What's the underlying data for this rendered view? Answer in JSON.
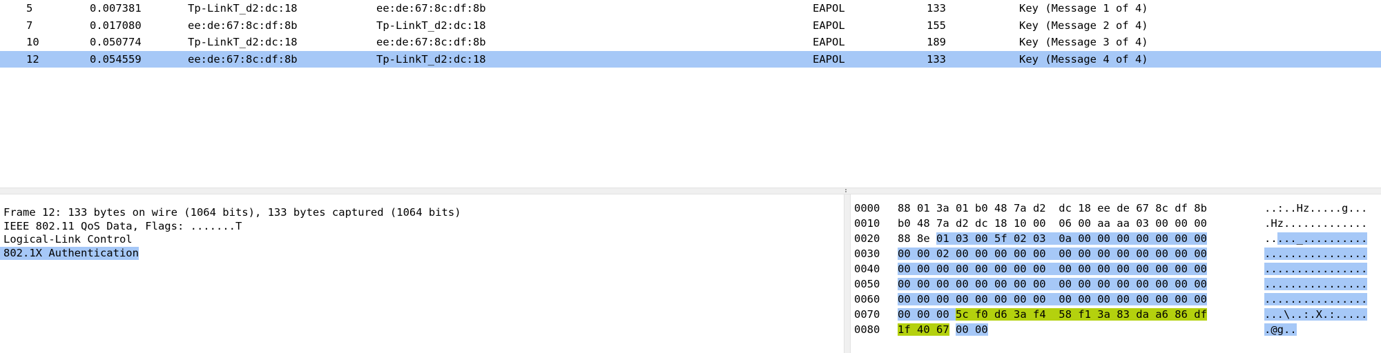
{
  "packet_list": {
    "rows": [
      {
        "no": "5",
        "time": "0.007381",
        "source": "Tp-LinkT_d2:dc:18",
        "destination": "ee:de:67:8c:df:8b",
        "protocol": "EAPOL",
        "length": "133",
        "info": "Key (Message 1 of 4)",
        "selected": false
      },
      {
        "no": "7",
        "time": "0.017080",
        "source": "ee:de:67:8c:df:8b",
        "destination": "Tp-LinkT_d2:dc:18",
        "protocol": "EAPOL",
        "length": "155",
        "info": "Key (Message 2 of 4)",
        "selected": false
      },
      {
        "no": "10",
        "time": "0.050774",
        "source": "Tp-LinkT_d2:dc:18",
        "destination": "ee:de:67:8c:df:8b",
        "protocol": "EAPOL",
        "length": "189",
        "info": "Key (Message 3 of 4)",
        "selected": false
      },
      {
        "no": "12",
        "time": "0.054559",
        "source": "ee:de:67:8c:df:8b",
        "destination": "Tp-LinkT_d2:dc:18",
        "protocol": "EAPOL",
        "length": "133",
        "info": "Key (Message 4 of 4)",
        "selected": true
      }
    ]
  },
  "details": {
    "lines": [
      {
        "text": "Frame 12: 133 bytes on wire (1064 bits), 133 bytes captured (1064 bits)",
        "selected": false
      },
      {
        "text": "IEEE 802.11 QoS Data, Flags: .......T",
        "selected": false
      },
      {
        "text": "Logical-Link Control",
        "selected": false
      },
      {
        "text": "802.1X Authentication",
        "selected": true
      }
    ]
  },
  "bytes": {
    "colors": {
      "selection": "#a6c8f7",
      "key_field": "#b4d10e"
    },
    "rows": [
      {
        "offset": "0000",
        "hex": [
          {
            "t": "88 01 3a 01 b0 48 7a d2  dc 18 ee de 67 8c df 8b",
            "h": ""
          }
        ],
        "ascii": [
          {
            "t": "..:..Hz.....g...",
            "h": ""
          }
        ]
      },
      {
        "offset": "0010",
        "hex": [
          {
            "t": "b0 48 7a d2 dc 18 10 00  06 00 aa aa 03 00 00 00",
            "h": ""
          }
        ],
        "ascii": [
          {
            "t": ".Hz.............",
            "h": ""
          }
        ]
      },
      {
        "offset": "0020",
        "hex": [
          {
            "t": "88 8e ",
            "h": ""
          },
          {
            "t": "01 03 00 5f 02 03  0a 00 00 00 00 00 00 00",
            "h": "hl"
          }
        ],
        "ascii": [
          {
            "t": "..",
            "h": ""
          },
          {
            "t": "..._..........",
            "h": "hl"
          }
        ]
      },
      {
        "offset": "0030",
        "hex": [
          {
            "t": "00 00 02 00 00 00 00 00  00 00 00 00 00 00 00 00",
            "h": "hl"
          }
        ],
        "ascii": [
          {
            "t": "................",
            "h": "hl"
          }
        ]
      },
      {
        "offset": "0040",
        "hex": [
          {
            "t": "00 00 00 00 00 00 00 00  00 00 00 00 00 00 00 00",
            "h": "hl"
          }
        ],
        "ascii": [
          {
            "t": "................",
            "h": "hl"
          }
        ]
      },
      {
        "offset": "0050",
        "hex": [
          {
            "t": "00 00 00 00 00 00 00 00  00 00 00 00 00 00 00 00",
            "h": "hl"
          }
        ],
        "ascii": [
          {
            "t": "................",
            "h": "hl"
          }
        ]
      },
      {
        "offset": "0060",
        "hex": [
          {
            "t": "00 00 00 00 00 00 00 00  00 00 00 00 00 00 00 00",
            "h": "hl"
          }
        ],
        "ascii": [
          {
            "t": "................",
            "h": "hl"
          }
        ]
      },
      {
        "offset": "0070",
        "hex": [
          {
            "t": "00 00 00 ",
            "h": "hl"
          },
          {
            "t": "5c f0 d6 3a f4  58 f1 3a 83 da a6 86 df",
            "h": "key"
          }
        ],
        "ascii": [
          {
            "t": "...",
            "h": "hl"
          },
          {
            "t": "\\..:.X.:.....",
            "h": "hl"
          }
        ]
      },
      {
        "offset": "0080",
        "hex": [
          {
            "t": "1f 40 67",
            "h": "key"
          },
          {
            "t": " ",
            "h": ""
          },
          {
            "t": "00 00",
            "h": "hl"
          }
        ],
        "ascii": [
          {
            "t": ".@g..",
            "h": "hl"
          }
        ]
      }
    ]
  }
}
